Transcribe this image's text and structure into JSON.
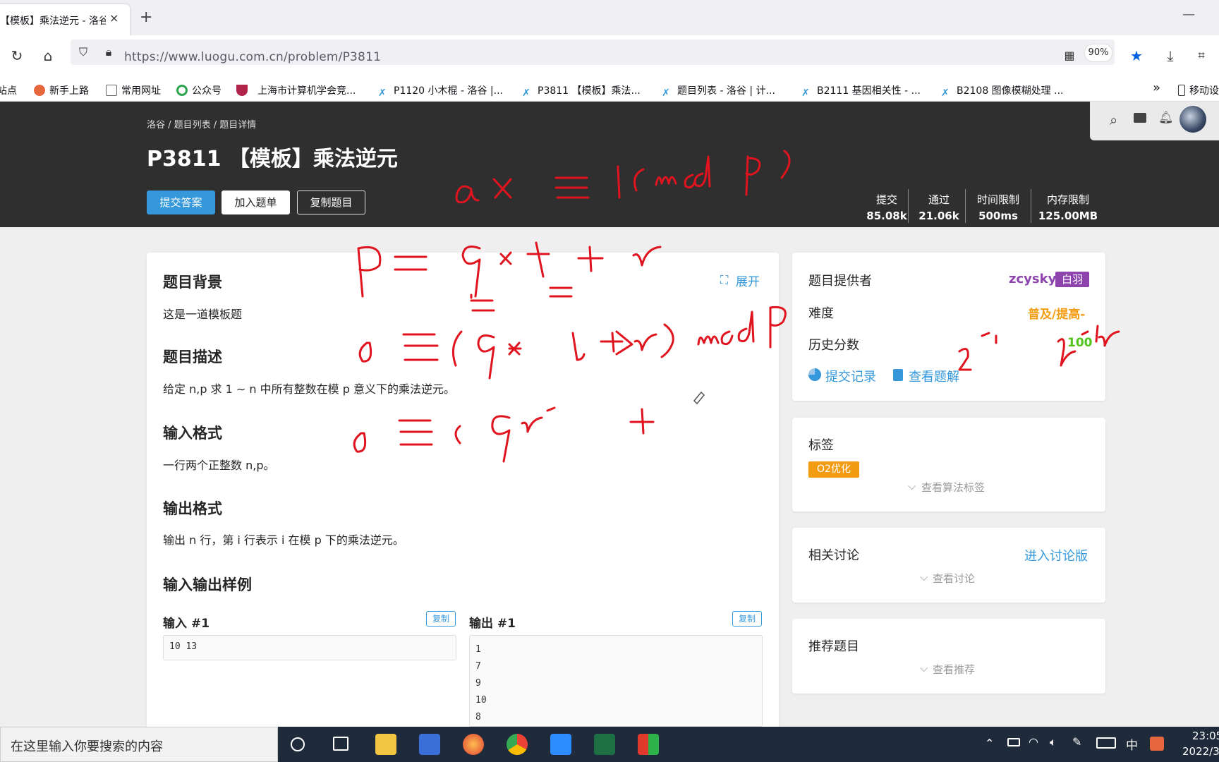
{
  "tab": {
    "title": "【模板】乘法逆元 - 洛谷",
    "close": "×",
    "new": "+"
  },
  "window": {
    "minimize": "—"
  },
  "nav": {
    "url": "https://www.luogu.com.cn/problem/P3811",
    "zoom": "90%"
  },
  "bookmarks": [
    {
      "label": "站点",
      "color": "#e85c1c"
    },
    {
      "label": "新手上路",
      "color": "#e8663d"
    },
    {
      "label": "常用网址",
      "color": "#666"
    },
    {
      "label": "公众号",
      "color": "#2ea44f"
    },
    {
      "label": "上海市计算机学会竞...",
      "color": "#b0244a"
    },
    {
      "label": "P1120 小木棍 - 洛谷 |...",
      "color": "#3498db"
    },
    {
      "label": "P3811 【模板】乘法...",
      "color": "#3498db"
    },
    {
      "label": "题目列表 - 洛谷 | 计...",
      "color": "#3498db"
    },
    {
      "label": "B2111 基因相关性 - ...",
      "color": "#3498db"
    },
    {
      "label": "B2108 图像模糊处理 ...",
      "color": "#3498db"
    },
    {
      "label": "移动设",
      "color": "#333"
    }
  ],
  "header": {
    "breadcrumb": "洛谷 / 题目列表 / 题目详情",
    "title": "P3811 【模板】乘法逆元",
    "buttons": [
      "提交答案",
      "加入题单",
      "复制题目"
    ],
    "stats": [
      {
        "label": "提交",
        "value": "85.08k"
      },
      {
        "label": "通过",
        "value": "21.06k"
      },
      {
        "label": "时间限制",
        "value": "500ms"
      },
      {
        "label": "内存限制",
        "value": "125.00MB"
      }
    ]
  },
  "problem": {
    "expand": "展开",
    "background_title": "题目背景",
    "background_text": "这是一道模板题",
    "desc_title": "题目描述",
    "desc_text": "给定 n,p 求 1 ∼ n 中所有整数在模 p 意义下的乘法逆元。",
    "input_title": "输入格式",
    "input_text": "一行两个正整数 n,p。",
    "output_title": "输出格式",
    "output_text": "输出 n 行，第 i 行表示 i 在模 p 下的乘法逆元。",
    "samples_title": "输入输出样例",
    "input1_label": "输入 #1",
    "output1_label": "输出 #1",
    "copy_label": "复制",
    "input1": "10 13",
    "output1": [
      "1",
      "7",
      "9",
      "10",
      "8"
    ]
  },
  "side": {
    "provider_label": "题目提供者",
    "provider_name": "zcysky",
    "provider_badge": "白羽",
    "difficulty_label": "难度",
    "difficulty_value": "普及/提高-",
    "history_label": "历史分数",
    "history_value": "100",
    "records_link": "提交记录",
    "solutions_link": "查看题解",
    "tags_title": "标签",
    "tag": "O2优化",
    "view_tags": "查看算法标签",
    "discuss_title": "相关讨论",
    "discuss_link": "进入讨论版",
    "view_discuss": "查看讨论",
    "recommend_title": "推荐题目",
    "view_recommend": "查看推荐"
  },
  "taskbar": {
    "search": "在这里输入你要搜索的内容",
    "time": "23:05",
    "date": "2022/3",
    "ime": "中"
  },
  "colors": {
    "accent": "#3498db",
    "header_bg": "#2f2f2f",
    "annotation": "#e0141e",
    "provider": "#8e44ad",
    "difficulty": "#f39c11",
    "score": "#52c41a",
    "tag": "#f39c11"
  }
}
